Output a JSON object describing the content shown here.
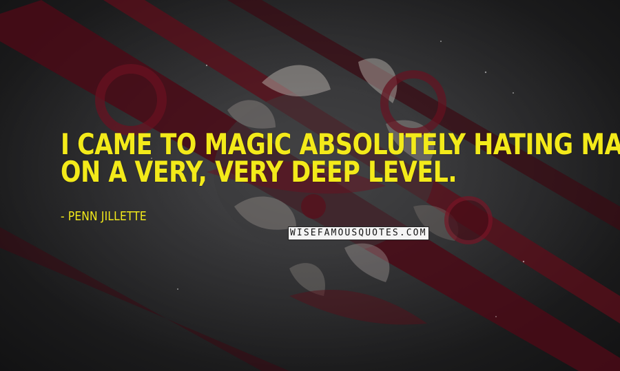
{
  "quote": {
    "line1": "I came to magic absolutely hating magic",
    "line2": "on a very, very deep level."
  },
  "author": "- Penn Jillette",
  "watermark": "WISEFAMOUSQUOTES.COM",
  "colors": {
    "text": "#f3ea1a",
    "background": "#232325",
    "stripe": "#5c0d1a",
    "watermark_bg": "#f4f4f4"
  }
}
